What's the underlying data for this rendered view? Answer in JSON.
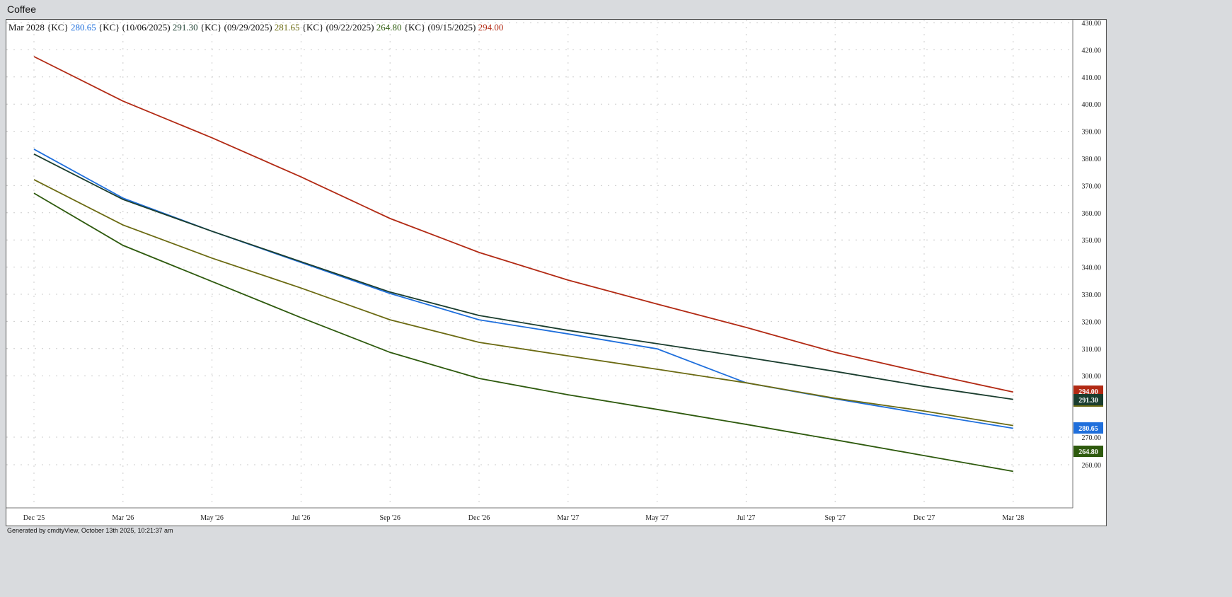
{
  "window": {
    "title": "Coffee"
  },
  "legend": [
    {
      "text": "Mar 2028 {KC}",
      "color": "#111111"
    },
    {
      "text": "280.65",
      "color": "#1f6fdc"
    },
    {
      "text": "{KC} (10/06/2025)",
      "color": "#111111"
    },
    {
      "text": "291.30",
      "color": "#1a3d2e"
    },
    {
      "text": "{KC} (09/29/2025)",
      "color": "#111111"
    },
    {
      "text": "281.65",
      "color": "#6b6a12"
    },
    {
      "text": "{KC} (09/22/2025)",
      "color": "#111111"
    },
    {
      "text": "264.80",
      "color": "#2e5a0e"
    },
    {
      "text": "{KC} (09/15/2025)",
      "color": "#111111"
    },
    {
      "text": "294.00",
      "color": "#b22a14"
    }
  ],
  "footer": "Generated by cmdtyView, October 13th 2025, 10:21:37 am",
  "chart_data": {
    "type": "line",
    "title": "Coffee",
    "xlabel": "",
    "ylabel": "",
    "categories": [
      "Dec '25",
      "Mar '26",
      "May '26",
      "Jul '26",
      "Sep '26",
      "Dec '26",
      "Mar '27",
      "May '27",
      "Jul '27",
      "Sep '27",
      "Dec '27",
      "Mar '28"
    ],
    "ylim": [
      253,
      430
    ],
    "yticks": [
      "430.00",
      "420.00",
      "410.00",
      "400.00",
      "390.00",
      "380.00",
      "370.00",
      "360.00",
      "350.00",
      "340.00",
      "330.00",
      "320.00",
      "310.00",
      "300.00",
      "270.00",
      "260.00"
    ],
    "ytick_values": [
      430,
      420,
      410,
      400,
      390,
      380,
      370,
      360,
      350,
      340,
      330,
      320,
      310,
      300,
      270,
      260
    ],
    "grid": true,
    "series": [
      {
        "name": "Mar 2028 {KC}",
        "color": "#1f6fdc",
        "last_label": "280.65",
        "values": [
          383.4,
          365.4,
          353.2,
          341.7,
          330.3,
          320.6,
          315.4,
          309.9,
          297.4,
          291.5,
          286.0,
          280.65
        ]
      },
      {
        "name": "{KC} (10/06/2025)",
        "color": "#1a3d2e",
        "last_label": "291.30",
        "values": [
          381.6,
          364.9,
          353.2,
          342.0,
          330.8,
          322.2,
          316.7,
          311.8,
          306.8,
          301.6,
          296.1,
          291.3
        ]
      },
      {
        "name": "{KC} (09/29/2025)",
        "color": "#6b6a12",
        "last_label": "281.65",
        "values": [
          372.2,
          355.5,
          343.3,
          332.3,
          320.6,
          312.3,
          307.3,
          302.4,
          297.4,
          291.7,
          287.0,
          281.65
        ]
      },
      {
        "name": "{KC} (09/22/2025)",
        "color": "#2e5a0e",
        "last_label": "264.80",
        "values": [
          367.2,
          348.0,
          334.7,
          321.4,
          308.6,
          299.0,
          293.0,
          287.6,
          282.1,
          276.4,
          270.6,
          264.8
        ]
      },
      {
        "name": "{KC} (09/15/2025)",
        "color": "#b22a14",
        "last_label": "294.00",
        "values": [
          417.5,
          401.1,
          387.6,
          373.2,
          357.9,
          345.4,
          335.2,
          326.4,
          317.8,
          308.6,
          301.1,
          294.0
        ]
      }
    ]
  }
}
